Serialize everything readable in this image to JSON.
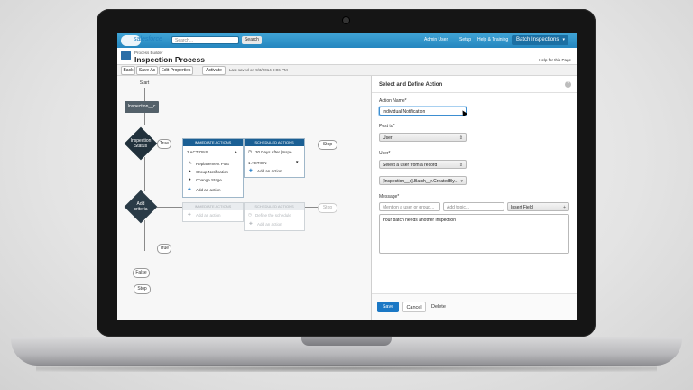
{
  "header": {
    "brand": "salesforce",
    "search_placeholder": "Search...",
    "search_button": "Search",
    "user_menu": "Admin User",
    "setup": "Setup",
    "help_training": "Help & Training",
    "app_menu": "Batch Inspections"
  },
  "page": {
    "app_name": "Process Builder",
    "process_name": "Inspection Process",
    "help_link": "Help for this Page"
  },
  "toolbar": {
    "back": "Back",
    "save_as": "Save As",
    "edit_properties": "Edit Properties",
    "activate": "Activate",
    "status": "Last saved on 9/3/2014 9:06 PM"
  },
  "canvas": {
    "start": "Start",
    "object_node": "Inspection__c",
    "criteria1": [
      "Inspection",
      "Status"
    ],
    "criteria2": [
      "Add",
      "criteria"
    ],
    "true_label": "True",
    "false_label": "False",
    "stop_label": "Stop",
    "group1": {
      "immediate_header": "IMMEDIATE ACTIONS",
      "actions_count": "3 ACTIONS",
      "actions": [
        "Replacement Post",
        "Group Notification",
        "Change Stage"
      ],
      "add_action": "Add an action",
      "scheduled_header": "SCHEDULED ACTIONS",
      "schedule": "30 Days After [Inspe...",
      "scheduled_count": "1 ACTION",
      "scheduled_add": "Add an action"
    },
    "group2": {
      "immediate_header": "IMMEDIATE ACTIONS",
      "add_action": "Add an action",
      "scheduled_header": "SCHEDULED ACTIONS",
      "schedule": "Define the schedule",
      "scheduled_add": "Add an action"
    }
  },
  "panel": {
    "title": "Select and Define Action",
    "action_name_label": "Action Name*",
    "action_name_value": "Individual Notification",
    "post_to_label": "Post to*",
    "post_to_value": "User",
    "user_label": "User*",
    "user_value": "Select a user from a record",
    "record_value": "[Inspection__c].Batch__r.CreatedBy...",
    "message_label": "Message*",
    "mention_placeholder": "Mention a user or group...",
    "topic_placeholder": "Add topic...",
    "insert_field": "Insert Field",
    "message_text": "Your batch needs another inspection",
    "save": "Save",
    "cancel": "Cancel",
    "delete": "Delete"
  }
}
